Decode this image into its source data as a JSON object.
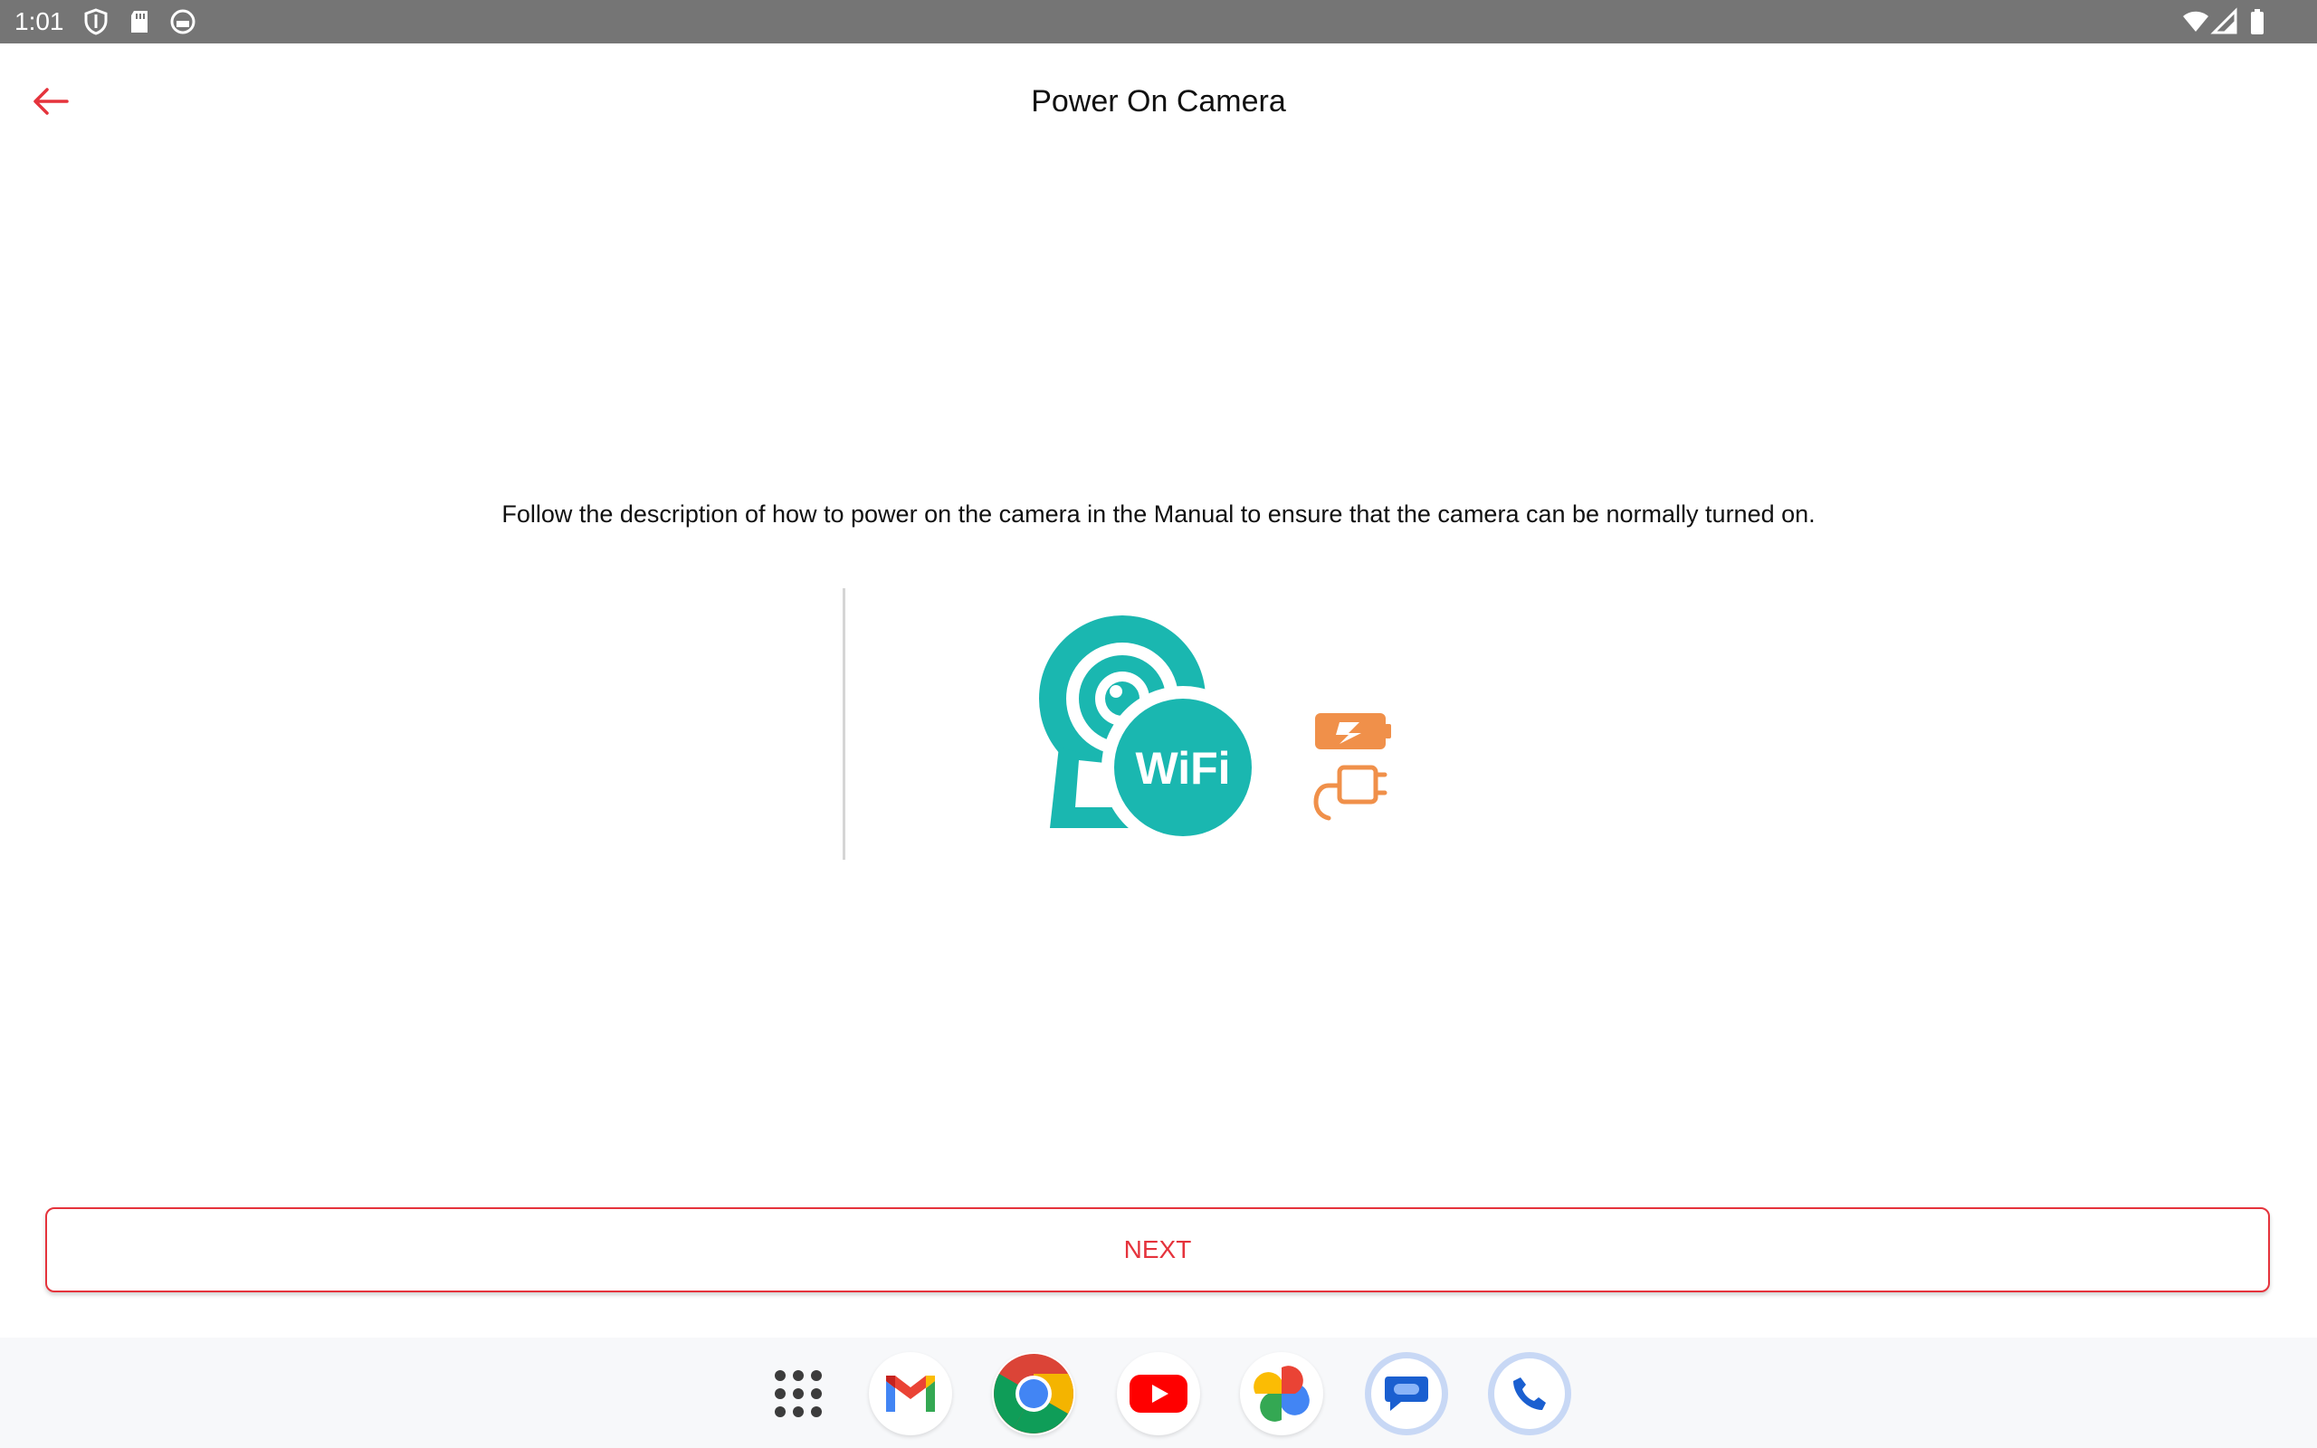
{
  "status_bar": {
    "time": "1:01",
    "left_icons": [
      "shield-icon",
      "sd-card-icon",
      "app-circle-icon"
    ],
    "right_icons": [
      "wifi-icon",
      "cellular-signal-icon",
      "battery-icon"
    ]
  },
  "header": {
    "back_icon": "arrow-left-icon",
    "title": "Power On Camera"
  },
  "main": {
    "instruction": "Follow the description of how to power on the camera in the Manual to ensure that the camera can be normally turned on.",
    "illustration": {
      "badge_text": "WiFi",
      "icons": [
        "wifi-camera-icon",
        "battery-charge-icon",
        "power-adapter-icon"
      ]
    }
  },
  "actions": {
    "next_label": "NEXT"
  },
  "dock": {
    "apps": [
      "apps-grid-icon",
      "gmail-icon",
      "chrome-icon",
      "youtube-icon",
      "photos-icon",
      "messages-icon",
      "phone-icon"
    ]
  },
  "colors": {
    "accent": "#e5333c",
    "teal": "#1ab7b0",
    "orange": "#f0904a",
    "status_bar": "#757575"
  }
}
